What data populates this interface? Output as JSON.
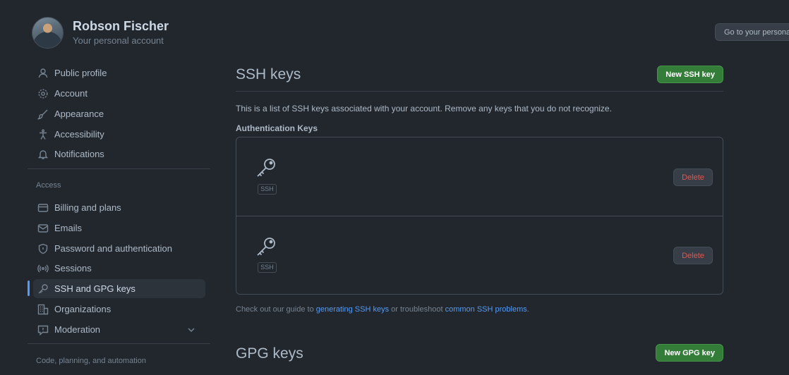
{
  "account": {
    "name": "Robson Fischer",
    "subtitle": "Your personal account",
    "go_button": "Go to your personal profile"
  },
  "sidebar": {
    "items": [
      {
        "label": "Public profile",
        "icon": "person-icon"
      },
      {
        "label": "Account",
        "icon": "gear-icon"
      },
      {
        "label": "Appearance",
        "icon": "paintbrush-icon"
      },
      {
        "label": "Accessibility",
        "icon": "accessibility-icon"
      },
      {
        "label": "Notifications",
        "icon": "bell-icon"
      }
    ],
    "access_label": "Access",
    "access_items": [
      {
        "label": "Billing and plans",
        "icon": "credit-card-icon"
      },
      {
        "label": "Emails",
        "icon": "mail-icon"
      },
      {
        "label": "Password and authentication",
        "icon": "shield-icon"
      },
      {
        "label": "Sessions",
        "icon": "broadcast-icon"
      },
      {
        "label": "SSH and GPG keys",
        "icon": "key-icon",
        "active": true
      },
      {
        "label": "Organizations",
        "icon": "organization-icon"
      },
      {
        "label": "Moderation",
        "icon": "report-icon"
      }
    ],
    "code_label": "Code, planning, and automation"
  },
  "ssh": {
    "title": "SSH keys",
    "new_button": "New SSH key",
    "description": "This is a list of SSH keys associated with your account. Remove any keys that you do not recognize.",
    "auth_title": "Authentication Keys",
    "keys": [
      {
        "badge": "SSH",
        "delete_label": "Delete"
      },
      {
        "badge": "SSH",
        "delete_label": "Delete"
      }
    ],
    "guide_prefix": "Check out our guide to ",
    "guide_link1": "generating SSH keys",
    "guide_mid": " or troubleshoot ",
    "guide_link2": "common SSH problems",
    "guide_suffix": "."
  },
  "gpg": {
    "title": "GPG keys",
    "new_button": "New GPG key"
  },
  "colors": {
    "background": "#22272e",
    "accent": "#539bf5",
    "green": "#347d39",
    "danger": "#e5534b"
  }
}
